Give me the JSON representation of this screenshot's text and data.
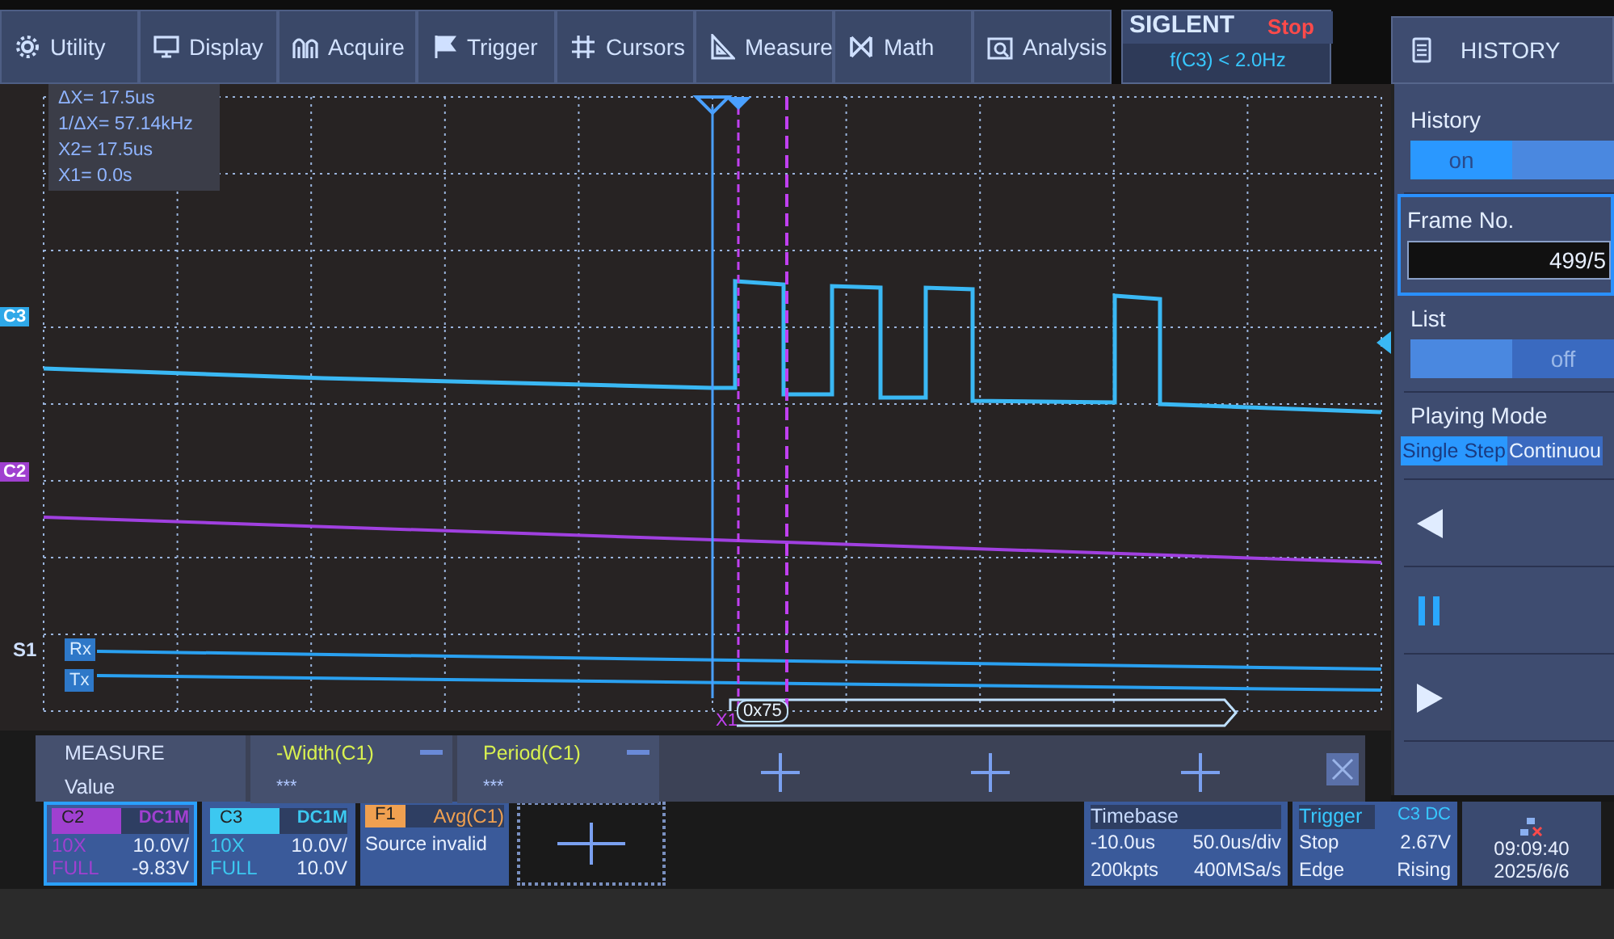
{
  "menu": [
    {
      "label": "Utility"
    },
    {
      "label": "Display"
    },
    {
      "label": "Acquire"
    },
    {
      "label": "Trigger"
    },
    {
      "label": "Cursors"
    },
    {
      "label": "Measure"
    },
    {
      "label": "Math"
    },
    {
      "label": "Analysis"
    }
  ],
  "status": {
    "brand": "SIGLENT",
    "run_state": "Stop",
    "trigger_frequency": "f(C3) < 2.0Hz"
  },
  "history_button": {
    "label": "HISTORY"
  },
  "cursor_readout": [
    "ΔX= 17.5us",
    "1/ΔX= 57.14kHz",
    "X2= 17.5us",
    "X1= 0.0s"
  ],
  "plot": {
    "channel_markers": [
      {
        "label": "C3",
        "color": "#2fa8e8"
      },
      {
        "label": "C2",
        "color": "#a040d0"
      }
    ],
    "bus": {
      "label": "S1",
      "lines": [
        "Rx",
        "Tx"
      ],
      "decode": "0x75"
    },
    "cursor_label": "X1"
  },
  "history_panel": {
    "history": {
      "label": "History",
      "value": "on",
      "on": true
    },
    "frame": {
      "label": "Frame No.",
      "value": "499/5"
    },
    "list": {
      "label": "List",
      "value": "off",
      "on": false
    },
    "playing_mode": {
      "label": "Playing Mode",
      "options": [
        {
          "label": "Single Step",
          "selected": true
        },
        {
          "label": "Continuou",
          "selected": false
        }
      ]
    }
  },
  "measure": {
    "header": "MEASURE",
    "row_label": "Value",
    "items": [
      {
        "name": "-Width(C1)",
        "value": "***"
      },
      {
        "name": "Period(C1)",
        "value": "***"
      }
    ]
  },
  "channels": [
    {
      "label": "C2",
      "coupling": "DC1M",
      "probe": "10X",
      "scale": "10.0V/",
      "mode": "FULL",
      "offset": "-9.83V",
      "color": "#a040d0",
      "selected": true
    },
    {
      "label": "C3",
      "coupling": "DC1M",
      "probe": "10X",
      "scale": "10.0V/",
      "mode": "FULL",
      "offset": "10.0V",
      "color": "#3cc8f0",
      "selected": false
    }
  ],
  "function": {
    "label": "F1",
    "source": "Avg(C1)",
    "message": "Source invalid"
  },
  "timebase": {
    "title": "Timebase",
    "delay": "-10.0us",
    "scale": "50.0us/div",
    "memory": "200kpts",
    "sample_rate": "400MSa/s"
  },
  "trigger": {
    "title": "Trigger",
    "source": "C3 DC",
    "state": "Stop",
    "level": "2.67V",
    "type": "Edge",
    "slope": "Rising"
  },
  "clock": {
    "time": "09:09:40",
    "date": "2025/6/6"
  }
}
